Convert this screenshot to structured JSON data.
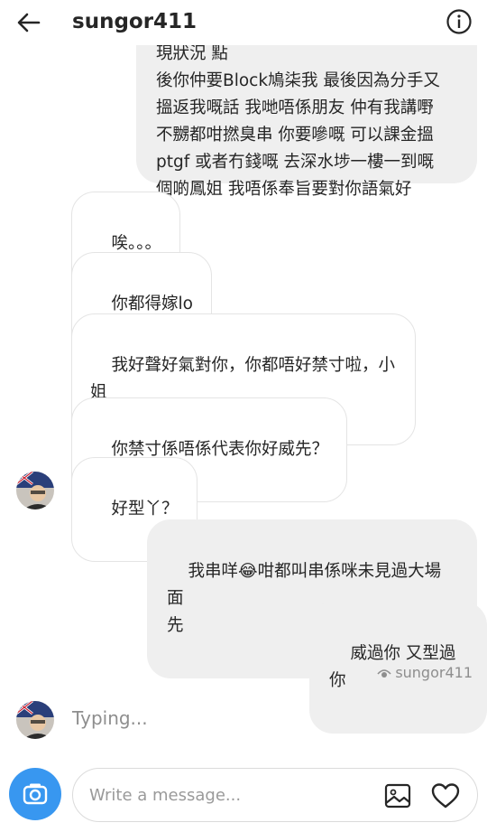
{
  "header": {
    "username": "sungor411"
  },
  "messages": [
    {
      "sender": "me",
      "text": "如果因為你講咗衰嘢我係身上只會出現狀況 點\n後你仲要Block鳩柒我 最後因為分手又\n搵返我嘅話 我哋唔係朋友 仲有我講嘢\n不嬲都咁撚臭串 你要嘇嘅 可以課金搵\nptgf 或者冇錢嘅 去深水埗一樓一到嘅\n個啲鳳姐 我唔係奉旨要對你語氣好"
    },
    {
      "sender": "them",
      "text": "唉。。。"
    },
    {
      "sender": "them",
      "text": "你都得嫁lo"
    },
    {
      "sender": "them",
      "text": "我好聲好氣對你，你都唔好禁寸啦，小\n姐"
    },
    {
      "sender": "them",
      "text": "你禁寸係唔係代表你好威先？"
    },
    {
      "sender": "them",
      "text": "好型丫？"
    },
    {
      "sender": "me",
      "text_before": "我串咩",
      "emoji": "😂",
      "text_after": "咁都叫串係咪未見過大場面\n先"
    },
    {
      "sender": "me",
      "text": "威過你 又型過你"
    }
  ],
  "seen": {
    "label": "sungor411"
  },
  "typing": {
    "label": "Typing..."
  },
  "composer": {
    "placeholder": "Write a message..."
  },
  "colors": {
    "accent": "#3897f0",
    "my_bubble": "#efefef",
    "their_border": "#e4e4e4",
    "muted_text": "#8e8e8e"
  }
}
